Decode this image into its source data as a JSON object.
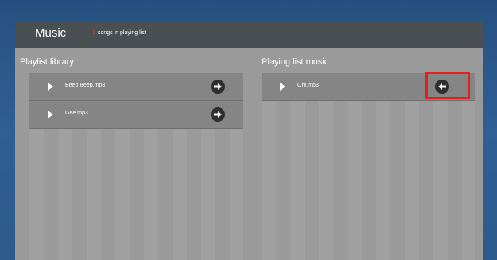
{
  "header": {
    "title": "Music",
    "count": "1",
    "subtitle": "songs in playing list"
  },
  "library": {
    "title": "Playlist library",
    "items": [
      {
        "name": "Beep Beep.mp3",
        "action_icon": "arrow-right-icon"
      },
      {
        "name": "Gee.mp3",
        "action_icon": "arrow-right-icon"
      }
    ]
  },
  "playing": {
    "title": "Playing list music",
    "items": [
      {
        "name": "Oh!.mp3",
        "action_icon": "arrow-left-icon"
      }
    ]
  },
  "colors": {
    "background": "#2f5a8e",
    "header": "#4a4f54",
    "panel": "#9a9a9a",
    "row": "#858585",
    "highlight": "#e32020",
    "count_accent": "#d0342c"
  }
}
